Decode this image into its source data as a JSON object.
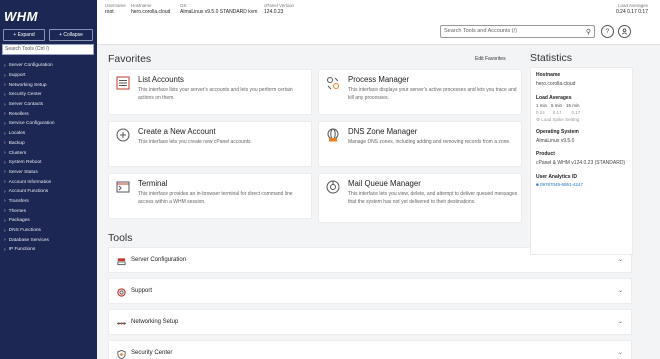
{
  "sidebar": {
    "logo": "WHM",
    "expand_label": "+ Expand",
    "collapse_label": "+ Collapse",
    "search_placeholder": "Search Tools (Ctrl /)",
    "items": [
      "Server Configuration",
      "Support",
      "Networking Setup",
      "Security Center",
      "Server Contacts",
      "Resellers",
      "Service Configuration",
      "Locales",
      "Backup",
      "Clusters",
      "System Reboot",
      "Server Status",
      "Account Information",
      "Account Functions",
      "Transfers",
      "Themes",
      "Packages",
      "DNS Functions",
      "Database Services",
      "IP Functions"
    ]
  },
  "topbar": {
    "username_label": "Username",
    "username": "root",
    "hostname_label": "Hostname",
    "hostname": "hero.corolla.cloud",
    "os_label": "OS",
    "os": "AlmaLinux v9.5.0 STANDARD kvm",
    "version_label": "cPanel Version",
    "version": "124.0.23",
    "load_label": "Load Averages",
    "load": "0.24  0.17  0.17",
    "search_placeholder": "Search Tools and Accounts (/)",
    "help_icon": "?",
    "user_icon": "user-icon"
  },
  "favorites": {
    "title": "Favorites",
    "edit_label": "Edit Favorites",
    "cards": [
      {
        "title": "List Accounts",
        "desc": "This interface lists your server's accounts and lets you perform certain actions on them."
      },
      {
        "title": "Process Manager",
        "desc": "This interface displays your server's active processes and lets you trace and kill any processes."
      },
      {
        "title": "Create a New Account",
        "desc": "This interface lets you create new cPanel accounts."
      },
      {
        "title": "DNS Zone Manager",
        "desc": "Manage DNS zones, including adding and removing records from a zone."
      },
      {
        "title": "Terminal",
        "desc": "This interface provides an in-browser terminal for direct command line access within a WHM session."
      },
      {
        "title": "Mail Queue Manager",
        "desc": "This interface lets you view, delete, and attempt to deliver queued messages that the system has not yet delivered to their destinations."
      }
    ]
  },
  "tools": {
    "title": "Tools",
    "rows": [
      "Server Configuration",
      "Support",
      "Networking Setup",
      "Security Center"
    ]
  },
  "stats": {
    "title": "Statistics",
    "hostname_label": "Hostname",
    "hostname": "hero.corolla.cloud",
    "load_label": "Load Averages",
    "load_headers": [
      "1 min",
      "5 min",
      "15 min"
    ],
    "load_values": [
      "0.24",
      "0.17",
      "0.17"
    ],
    "load_spike_link": "Load Spike Setting",
    "os_label": "Operating System",
    "os": "AlmaLinux v9.5.0",
    "product_label": "Product",
    "product": "cPanel & WHM v124.0.23 (STANDARD)",
    "analytics_label": "User Analytics ID",
    "analytics_id": "09787049-6951-4247"
  },
  "colors": {
    "sidebar_bg": "#1d2753",
    "accent": "#1a73c8"
  }
}
